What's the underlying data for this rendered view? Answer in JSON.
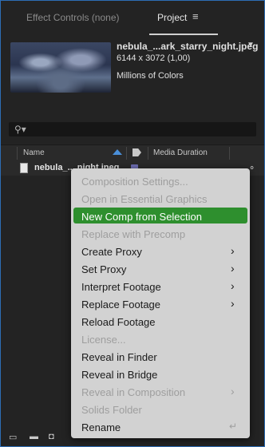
{
  "tabs": {
    "effect_controls": "Effect Controls (none)",
    "project": "Project",
    "menu_icon": "hamburger-menu-icon"
  },
  "asset": {
    "name": "nebula_...ark_starry_night.jpeg",
    "dims": "6144 x 3072 (1,00)",
    "colors": "Millions of Colors"
  },
  "columns": {
    "name": "Name",
    "media_duration": "Media Duration"
  },
  "row": {
    "file_name": "nebula_....night.jpeg"
  },
  "context_menu": {
    "items": [
      {
        "label": "Composition Settings...",
        "disabled": true
      },
      {
        "label": "Open in Essential Graphics",
        "disabled": true
      },
      {
        "label": "New Comp from Selection",
        "selected": true
      },
      {
        "label": "Replace with Precomp",
        "disabled": true
      },
      {
        "label": "Create Proxy",
        "submenu": true
      },
      {
        "label": "Set Proxy",
        "submenu": true
      },
      {
        "label": "Interpret Footage",
        "submenu": true
      },
      {
        "label": "Replace Footage",
        "submenu": true
      },
      {
        "label": "Reload Footage"
      },
      {
        "label": "License...",
        "disabled": true
      },
      {
        "label": "Reveal in Finder"
      },
      {
        "label": "Reveal in Bridge"
      },
      {
        "label": "Reveal in Composition",
        "disabled": true,
        "submenu": true
      },
      {
        "label": "Solids Folder",
        "disabled": true
      },
      {
        "label": "Rename",
        "enter": true
      }
    ]
  },
  "colors": {
    "highlight": "#2e8f2e",
    "accent": "#2d6db5",
    "menu_bg": "#d2d2d2"
  }
}
